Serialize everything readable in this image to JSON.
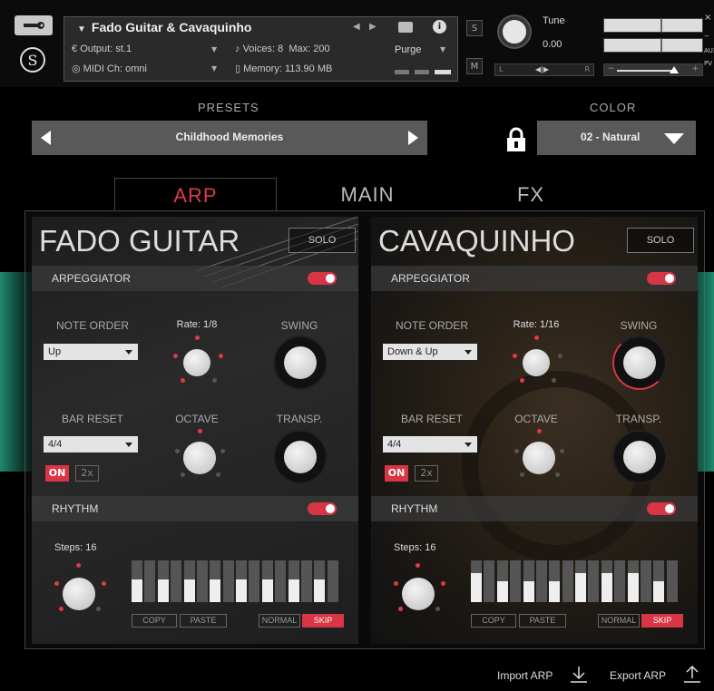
{
  "header": {
    "instrument_title": "Fado Guitar & Cavaquinho",
    "output": "Output:",
    "output_value": "st.1",
    "voices_label": "Voices:",
    "voices_value": "8",
    "max_label": "Max:",
    "max_value": "200",
    "midi_label": "MIDI Ch:",
    "midi_value": "omni",
    "memory_label": "Memory:",
    "memory_value": "113.90 MB",
    "purge": "Purge",
    "solo": "S",
    "mute": "M",
    "tune_label": "Tune",
    "tune_value": "0.00",
    "pan_left": "L",
    "pan_center": "◀|▶",
    "pan_right": "R",
    "aux": "AUX",
    "pv": "PV"
  },
  "presets": {
    "label": "PRESETS",
    "current": "Childhood Memories"
  },
  "color": {
    "label": "COLOR",
    "current": "02 - Natural"
  },
  "tabs": [
    {
      "label": "ARP",
      "active": true
    },
    {
      "label": "MAIN",
      "active": false
    },
    {
      "label": "FX",
      "active": false
    }
  ],
  "panels": [
    {
      "title": "FADO GUITAR",
      "solo": "SOLO",
      "arpeggiator": "ARPEGGIATOR",
      "note_order_label": "NOTE ORDER",
      "note_order": "Up",
      "rate_label": "Rate: 1/8",
      "swing_label": "SWING",
      "bar_reset_label": "BAR RESET",
      "bar_reset": "4/4",
      "octave_label": "OCTAVE",
      "transp_label": "TRANSP.",
      "on": "ON",
      "x2": "2x",
      "rhythm": "RHYTHM",
      "steps_label": "Steps: 16",
      "copy": "COPY",
      "paste": "PASTE",
      "normal": "NORMAL",
      "skip": "SKIP",
      "step_levels": [
        0.55,
        0.55,
        0.55,
        0.55,
        0.55,
        0.55,
        0.55,
        0.55,
        0.55,
        0.55,
        0.55,
        0.55,
        0.55,
        0.55,
        0.55,
        0.55
      ]
    },
    {
      "title": "CAVAQUINHO",
      "solo": "SOLO",
      "arpeggiator": "ARPEGGIATOR",
      "note_order_label": "NOTE ORDER",
      "note_order": "Down & Up",
      "rate_label": "Rate: 1/16",
      "swing_label": "SWING",
      "bar_reset_label": "BAR RESET",
      "bar_reset": "4/4",
      "octave_label": "OCTAVE",
      "transp_label": "TRANSP.",
      "on": "ON",
      "x2": "2x",
      "rhythm": "RHYTHM",
      "steps_label": "Steps: 16",
      "copy": "COPY",
      "paste": "PASTE",
      "normal": "NORMAL",
      "skip": "SKIP",
      "step_levels": [
        0.7,
        0.7,
        0.5,
        0.7,
        0.5,
        0.7,
        0.5,
        0.7,
        0.7,
        0.5,
        0.7,
        0.5,
        0.7,
        0.5,
        0.5,
        0.7
      ]
    }
  ],
  "footer": {
    "import": "Import ARP",
    "export": "Export ARP"
  },
  "colors": {
    "accent": "#d83545",
    "panel_bg": "#1e1e1e",
    "teal_glow": "#1f8a6e"
  }
}
